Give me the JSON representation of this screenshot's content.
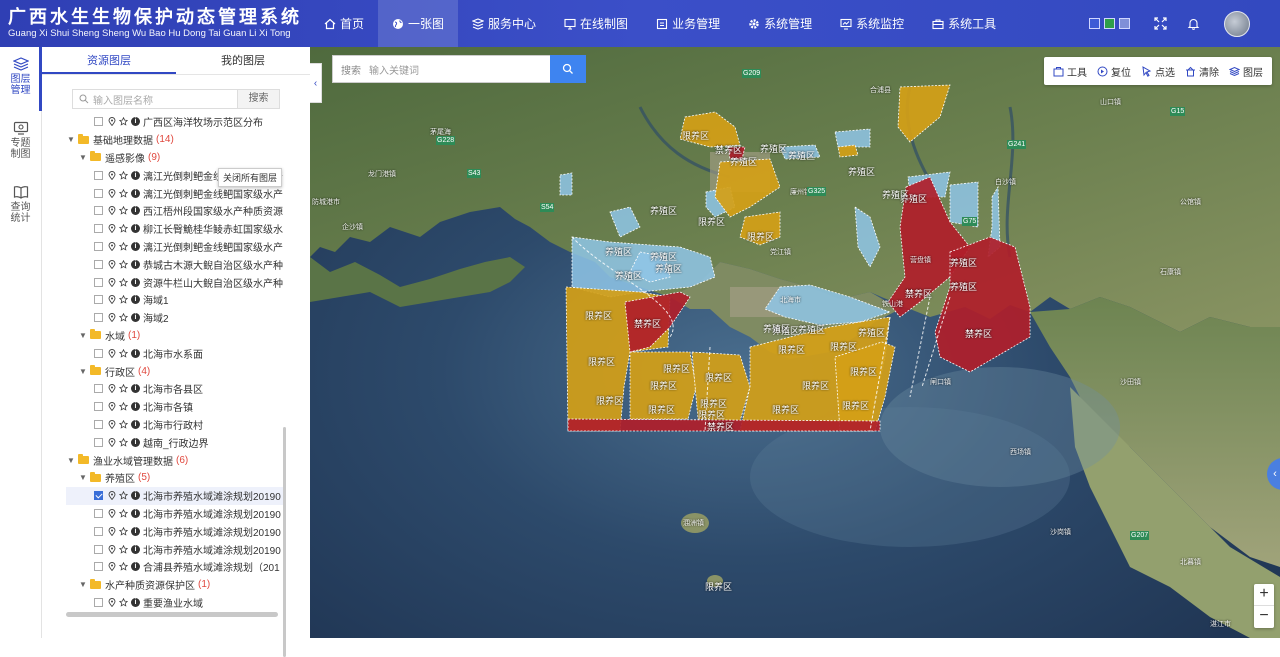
{
  "app": {
    "title_cn": "广西水生生物保护动态管理系统",
    "title_py": "Guang Xi Shui Sheng Sheng Wu Bao Hu Dong Tai Guan Li Xi Tong"
  },
  "nav": [
    {
      "label": "首页",
      "icon": "home-icon"
    },
    {
      "label": "一张图",
      "icon": "globe-icon",
      "active": true
    },
    {
      "label": "服务中心",
      "icon": "service-icon"
    },
    {
      "label": "在线制图",
      "icon": "monitor-icon"
    },
    {
      "label": "业务管理",
      "icon": "business-icon"
    },
    {
      "label": "系统管理",
      "icon": "gear-icon"
    },
    {
      "label": "系统监控",
      "icon": "monitor-chart-icon"
    },
    {
      "label": "系统工具",
      "icon": "toolbox-icon"
    }
  ],
  "theme_colors": [
    "#3d5bd6",
    "#2e9e4a",
    "#7f8fd8"
  ],
  "rail": [
    {
      "label": "图层管理",
      "icon": "layers-icon",
      "active": true
    },
    {
      "label": "专题制图",
      "icon": "map-theme-icon"
    },
    {
      "label": "查询统计",
      "icon": "book-icon"
    }
  ],
  "panel": {
    "tabs": [
      {
        "label": "资源图层",
        "active": true
      },
      {
        "label": "我的图层"
      }
    ],
    "search_placeholder": "输入图层名称",
    "search_button": "搜索",
    "tooltip": "关闭所有图层"
  },
  "tree": [
    {
      "level": 3,
      "type": "leaf",
      "label": "广西区海洋牧场示范区分布"
    },
    {
      "level": 1,
      "type": "group",
      "label": "基础地理数据",
      "count": "(14)"
    },
    {
      "level": 2,
      "type": "group",
      "label": "遥感影像",
      "count": "(9)"
    },
    {
      "level": 3,
      "type": "leaf",
      "label": "漓江光倒刺鲃金线鲃国家级水产"
    },
    {
      "level": 3,
      "type": "leaf",
      "label": "漓江光倒刺鲃金线鲃国家级水产"
    },
    {
      "level": 3,
      "type": "leaf",
      "label": "西江梧州段国家级水产种质资源"
    },
    {
      "level": 3,
      "type": "leaf",
      "label": "柳江长臀鮠桂华鲮赤虹国家级水"
    },
    {
      "level": 3,
      "type": "leaf",
      "label": "漓江光倒刺鲃金线鲃国家级水产"
    },
    {
      "level": 3,
      "type": "leaf",
      "label": "恭城古木源大鲵自治区级水产种"
    },
    {
      "level": 3,
      "type": "leaf",
      "label": "资源牛栏山大鲵自治区级水产种"
    },
    {
      "level": 3,
      "type": "leaf",
      "label": "海域1"
    },
    {
      "level": 3,
      "type": "leaf",
      "label": "海域2"
    },
    {
      "level": 2,
      "type": "group",
      "label": "水域",
      "count": "(1)"
    },
    {
      "level": 3,
      "type": "leaf",
      "label": "北海市水系面"
    },
    {
      "level": 2,
      "type": "group",
      "label": "行政区",
      "count": "(4)"
    },
    {
      "level": 3,
      "type": "leaf",
      "label": "北海市各县区"
    },
    {
      "level": 3,
      "type": "leaf",
      "label": "北海市各镇"
    },
    {
      "level": 3,
      "type": "leaf",
      "label": "北海市行政村"
    },
    {
      "level": 3,
      "type": "leaf",
      "label": "越南_行政边界"
    },
    {
      "level": 1,
      "type": "group",
      "label": "渔业水域管理数据",
      "count": "(6)"
    },
    {
      "level": 2,
      "type": "group",
      "label": "养殖区",
      "count": "(5)"
    },
    {
      "level": 3,
      "type": "leaf",
      "label": "北海市养殖水域滩涂规划20190",
      "checked": true,
      "highlight": true
    },
    {
      "level": 3,
      "type": "leaf",
      "label": "北海市养殖水域滩涂规划20190"
    },
    {
      "level": 3,
      "type": "leaf",
      "label": "北海市养殖水域滩涂规划20190"
    },
    {
      "level": 3,
      "type": "leaf",
      "label": "北海市养殖水域滩涂规划20190"
    },
    {
      "level": 3,
      "type": "leaf",
      "label": "合浦县养殖水域滩涂规划（201"
    },
    {
      "level": 2,
      "type": "group",
      "label": "水产种质资源保护区",
      "count": "(1)"
    },
    {
      "level": 3,
      "type": "leaf",
      "label": "重要渔业水域"
    }
  ],
  "map": {
    "search_prefix": "搜索",
    "search_placeholder": "输入关键词",
    "tools": [
      {
        "label": "工具",
        "icon": "toolbox-icon"
      },
      {
        "label": "复位",
        "icon": "reset-icon"
      },
      {
        "label": "点选",
        "icon": "pointer-icon"
      },
      {
        "label": "清除",
        "icon": "clear-icon"
      },
      {
        "label": "图层",
        "icon": "layers-icon"
      }
    ],
    "zoom_in": "+",
    "zoom_out": "−",
    "zone_colors": {
      "yangzhi": "#8fc5e8",
      "xianyang": "#d4a017",
      "jinyang": "#b01e2a"
    },
    "zone_labels": {
      "yangzhi": "养殖区",
      "xianyang": "限养区",
      "jinyang": "禁养区"
    },
    "places": [
      "北海市",
      "防城港市",
      "龙门港镇",
      "合浦县",
      "涠洲镇",
      "营盘镇",
      "沙田镇",
      "山口镇",
      "白沙镇",
      "石康镇",
      "廉州镇",
      "党江镇",
      "西场镇",
      "沙岗镇",
      "公馆镇",
      "闸口镇",
      "铁山港",
      "北暮镇",
      "湛江市",
      "茅尾海",
      "企沙镇"
    ],
    "roads": [
      "G209",
      "G228",
      "G325",
      "G75",
      "G241",
      "S43",
      "S54",
      "G15",
      "G207"
    ]
  }
}
